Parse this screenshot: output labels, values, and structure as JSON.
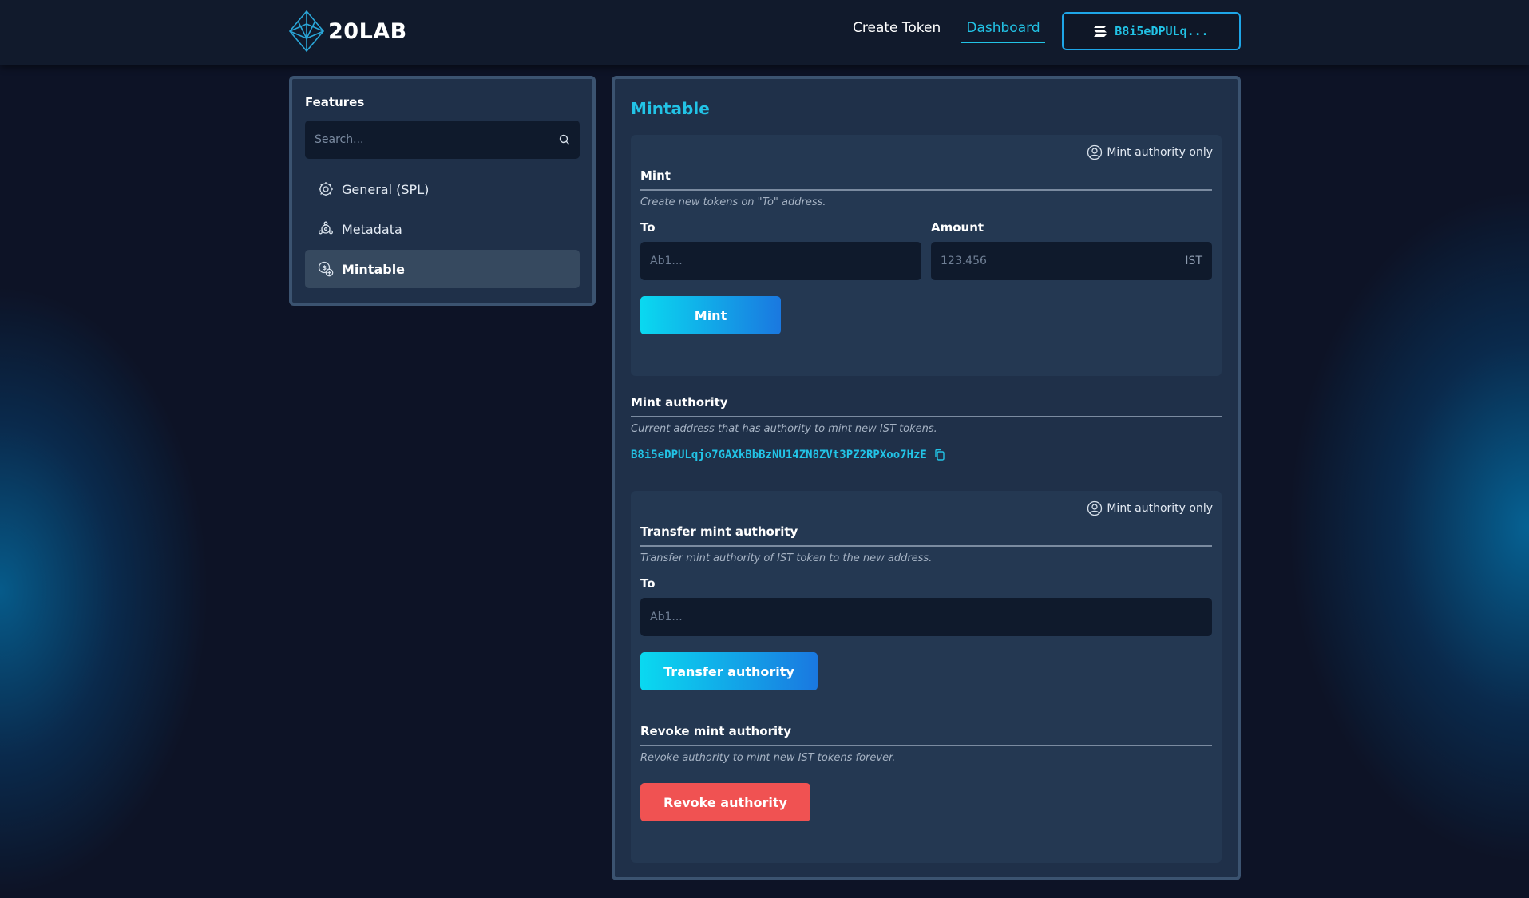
{
  "header": {
    "logo_text": "20LAB",
    "nav": {
      "create_token": "Create Token",
      "dashboard": "Dashboard"
    },
    "wallet_label": "B8i5eDPULq..."
  },
  "sidebar": {
    "title": "Features",
    "search_placeholder": "Search...",
    "items": [
      {
        "label": "General (SPL)",
        "icon": "gear-icon",
        "active": false
      },
      {
        "label": "Metadata",
        "icon": "metadata-icon",
        "active": false
      },
      {
        "label": "Mintable",
        "icon": "mint-icon",
        "active": true
      }
    ]
  },
  "main": {
    "title": "Mintable",
    "mint": {
      "badge": "Mint authority only",
      "title": "Mint",
      "description": "Create new tokens on \"To\" address.",
      "to_label": "To",
      "to_placeholder": "Ab1...",
      "amount_label": "Amount",
      "amount_placeholder": "123.456",
      "amount_unit": "IST",
      "button": "Mint"
    },
    "authority": {
      "title": "Mint authority",
      "description": "Current address that has authority to mint new IST tokens.",
      "address": "B8i5eDPULqjo7GAXkBbBzNU14ZN8ZVt3PZ2RPXoo7HzE"
    },
    "transfer": {
      "badge": "Mint authority only",
      "title": "Transfer mint authority",
      "description": "Transfer mint authority of IST token to the new address.",
      "to_label": "To",
      "to_placeholder": "Ab1...",
      "button": "Transfer authority"
    },
    "revoke": {
      "title": "Revoke mint authority",
      "description": "Revoke authority to mint new IST tokens forever.",
      "button": "Revoke authority"
    }
  },
  "colors": {
    "accent": "#22c3e6",
    "panel": "#1f3049",
    "danger": "#f05252"
  }
}
